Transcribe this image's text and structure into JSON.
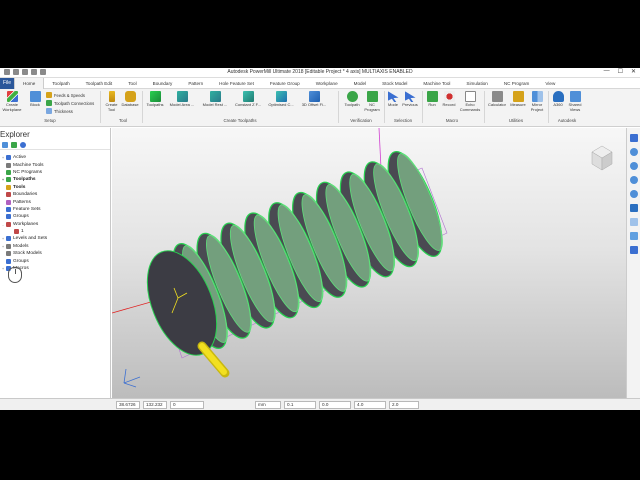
{
  "titlebar": {
    "title": "Autodesk PowerMill Ultimate 2018   [Editable Project * 4 axis]   MULTIAXIS ENABLED",
    "minimize": "—",
    "maximize": "☐",
    "close": "✕"
  },
  "tabs": [
    "Home",
    "Toolpath",
    "Toolpath Edit",
    "Tool",
    "Boundary",
    "Pattern",
    "Hole Feature Set",
    "Feature Group",
    "Workplane",
    "Model",
    "Stock Model",
    "Machine Tool",
    "Simulation",
    "NC Program",
    "View"
  ],
  "file_tab": "File",
  "ribbon": {
    "setup": {
      "create_workplane": "Create Workplane",
      "block": "Block",
      "feeds_speeds": "Feeds & Speeds",
      "toolpath_connections": "Toolpath Connections",
      "thickness": "Thickness",
      "label": "Setup"
    },
    "tool": {
      "create_tool": "Create Tool",
      "database": "Database",
      "label": "Tool"
    },
    "create_toolpaths": {
      "items": [
        "Toolpaths",
        "Model Area ...",
        "Model Rest ...",
        "Constant Z F...",
        "Optimised C...",
        "3D Offset Fi..."
      ],
      "label": "Create Toolpaths"
    },
    "verification": {
      "toolpath": "Toolpath",
      "nc_program": "NC Program",
      "label": "Verification"
    },
    "selection": {
      "mode": "Mode",
      "previous": "Previous",
      "label": "Selection"
    },
    "macro": {
      "run": "Run",
      "record": "Record",
      "echo_commands": "Echo Commands",
      "label": "Macro"
    },
    "utilities": {
      "calculator": "Calculator",
      "measure": "Measure",
      "mirror_project": "Mirror Project",
      "label": "Utilities"
    },
    "autodesk": {
      "a360": "A360",
      "shared_views": "Shared Views",
      "label": "Autodesk"
    }
  },
  "explorer": {
    "title": "Explorer",
    "tree": [
      {
        "label": "Active",
        "twisty": "+",
        "bold": false,
        "indent": 0,
        "color": "#3b6fd1"
      },
      {
        "label": "Machine Tools",
        "twisty": "",
        "bold": false,
        "indent": 0,
        "color": "#7a7a7a"
      },
      {
        "label": "NC Programs",
        "twisty": "",
        "bold": false,
        "indent": 0,
        "color": "#3aa548"
      },
      {
        "label": "Toolpaths",
        "twisty": "+",
        "bold": true,
        "indent": 0,
        "color": "#3aa548"
      },
      {
        "label": "Tools",
        "twisty": "",
        "bold": true,
        "indent": 0,
        "color": "#d5a21a"
      },
      {
        "label": "Boundaries",
        "twisty": "",
        "bold": false,
        "indent": 0,
        "color": "#c04848"
      },
      {
        "label": "Patterns",
        "twisty": "",
        "bold": false,
        "indent": 0,
        "color": "#b060c0"
      },
      {
        "label": "Feature Sets",
        "twisty": "",
        "bold": false,
        "indent": 0,
        "color": "#3b6fd1"
      },
      {
        "label": "Groups",
        "twisty": "",
        "bold": false,
        "indent": 0,
        "color": "#3b6fd1"
      },
      {
        "label": "Workplanes",
        "twisty": "-",
        "bold": false,
        "indent": 0,
        "color": "#c04848"
      },
      {
        "label": "1",
        "twisty": "",
        "bold": false,
        "indent": 1,
        "color": "#c04848"
      },
      {
        "label": "Levels and Sets",
        "twisty": "+",
        "bold": false,
        "indent": 0,
        "color": "#3b6fd1"
      },
      {
        "label": "Models",
        "twisty": "+",
        "bold": false,
        "indent": 0,
        "color": "#7a7a7a"
      },
      {
        "label": "Stock Models",
        "twisty": "",
        "bold": false,
        "indent": 0,
        "color": "#7a7a7a"
      },
      {
        "label": "Groups",
        "twisty": "",
        "bold": false,
        "indent": 0,
        "color": "#3b6fd1"
      },
      {
        "label": "Macros",
        "twisty": "+",
        "bold": false,
        "indent": 0,
        "color": "#3b6fd1"
      }
    ]
  },
  "status": {
    "x": "38.6726",
    "y": "132.232",
    "z": "0",
    "units": "mm",
    "tolerance": "0.1",
    "thickness": "0.0",
    "diameter": "4.0",
    "stepover": "2.0"
  },
  "colors": {
    "file_tab": "#2b579a",
    "toolpath_green": "#28d050",
    "stock_dark": "#3c3c44",
    "tool_yellow": "#f2e020",
    "workplane_magenta": "#d040d0"
  }
}
